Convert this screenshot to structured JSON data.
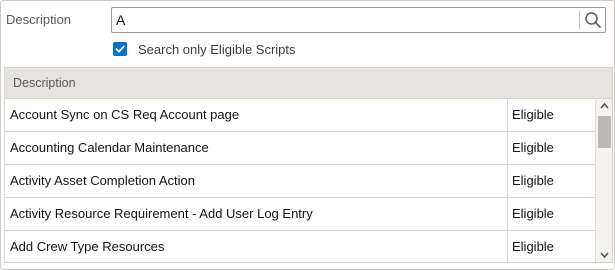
{
  "form": {
    "description_label": "Description",
    "search_value": "A",
    "checkbox_checked": true,
    "checkbox_label": "Search only Eligible Scripts"
  },
  "table": {
    "header": "Description",
    "rows": [
      {
        "description": "Account Sync on CS Req Account page",
        "status": "Eligible"
      },
      {
        "description": "Accounting Calendar Maintenance",
        "status": "Eligible"
      },
      {
        "description": "Activity Asset Completion Action",
        "status": "Eligible"
      },
      {
        "description": "Activity Resource Requirement - Add User Log Entry",
        "status": "Eligible"
      },
      {
        "description": "Add Crew Type Resources",
        "status": "Eligible"
      }
    ]
  },
  "icons": {
    "search": "search-icon",
    "checkbox": "checkmark-icon",
    "scroll_up": "chevron-up-icon",
    "scroll_down": "chevron-down-icon"
  },
  "colors": {
    "accent": "#0572ce",
    "header_bg": "#e6e4e1"
  }
}
